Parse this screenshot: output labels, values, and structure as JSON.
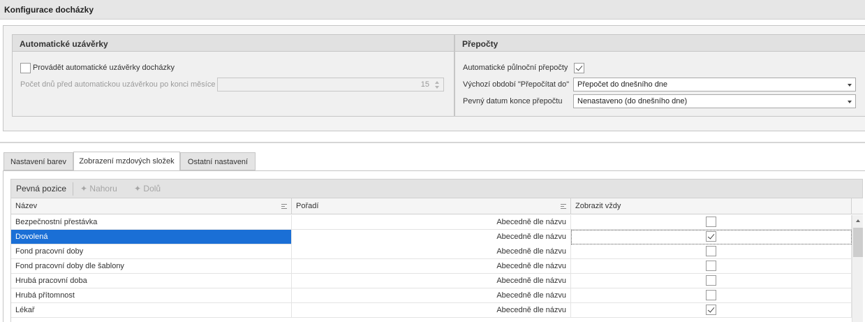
{
  "window": {
    "title": "Konfigurace docházky"
  },
  "auto_closures": {
    "header": "Automatické uzávěrky",
    "enable_label": "Provádět automatické uzávěrky docházky",
    "enable_checked": false,
    "days_label": "Počet dnů před automatickou uzávěrkou po konci měsíce",
    "days_value": "15"
  },
  "recalc": {
    "header": "Přepočty",
    "midnight_label": "Automatické půlnoční přepočty",
    "midnight_checked": true,
    "default_period_label": "Výchozí období \"Přepočítat do\"",
    "default_period_value": "Přepočet do dnešního dne",
    "fixed_date_label": "Pevný datum konce přepočtu",
    "fixed_date_value": "Nenastaveno (do dnešního dne)"
  },
  "tabs": [
    {
      "label": "Nastavení barev",
      "active": false
    },
    {
      "label": "Zobrazení mzdových složek",
      "active": true
    },
    {
      "label": "Ostatní nastavení",
      "active": false
    }
  ],
  "toolbar": {
    "fixed_position": "Pevná pozice",
    "up": "Nahoru",
    "down": "Dolů"
  },
  "grid": {
    "columns": [
      "Název",
      "Pořadí",
      "Zobrazit vždy"
    ],
    "rows": [
      {
        "name": "Bezpečnostní přestávka",
        "order": "Abecedně dle názvu",
        "always": false,
        "selected": false
      },
      {
        "name": "Dovolená",
        "order": "Abecedně dle názvu",
        "always": true,
        "selected": true
      },
      {
        "name": "Fond pracovní doby",
        "order": "Abecedně dle názvu",
        "always": false,
        "selected": false
      },
      {
        "name": "Fond pracovní doby dle šablony",
        "order": "Abecedně dle názvu",
        "always": false,
        "selected": false
      },
      {
        "name": "Hrubá pracovní doba",
        "order": "Abecedně dle názvu",
        "always": false,
        "selected": false
      },
      {
        "name": "Hrubá přítomnost",
        "order": "Abecedně dle názvu",
        "always": false,
        "selected": false
      },
      {
        "name": "Lékař",
        "order": "Abecedně dle názvu",
        "always": true,
        "selected": false
      }
    ]
  },
  "colors": {
    "selection": "#1a6fd6"
  }
}
